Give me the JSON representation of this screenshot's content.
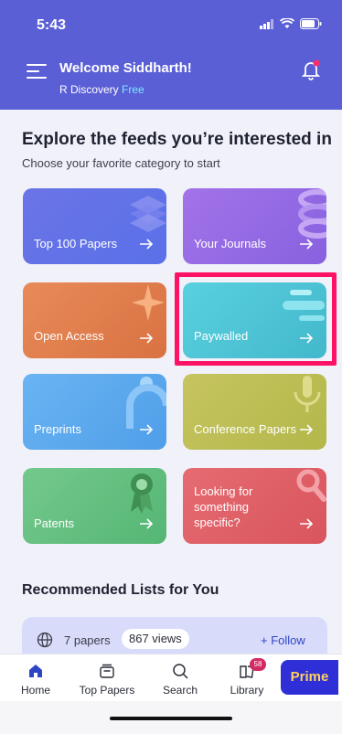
{
  "status_bar": {
    "time": "5:43"
  },
  "header": {
    "welcome": "Welcome Siddharth!",
    "app_name": "R Discovery",
    "plan": "Free"
  },
  "feeds": {
    "title": "Explore the feeds you’re interested in",
    "subtitle": "Choose your favorite category to start",
    "cards": [
      {
        "label": "Top 100 Papers",
        "color": "#6b74e6"
      },
      {
        "label": "Your Journals",
        "color": "#a273e9"
      },
      {
        "label": "Open Access",
        "color": "#e88a58"
      },
      {
        "label": "Paywalled",
        "color": "#59d0df",
        "highlighted": true
      },
      {
        "label": "Preprints",
        "color": "#6ab4f3"
      },
      {
        "label": "Conference Papers",
        "color": "#c6c460"
      },
      {
        "label": "Patents",
        "color": "#74c98c"
      },
      {
        "label": "Looking for something specific?",
        "color": "#e66b72"
      }
    ],
    "highlight_color": "#ff1265"
  },
  "recommended": {
    "title": "Recommended Lists for You",
    "papers": "7 papers",
    "views": "867 views",
    "follow": "+ Follow"
  },
  "nav": {
    "items": [
      {
        "label": "Home",
        "icon": "home-icon",
        "active": true
      },
      {
        "label": "Top Papers",
        "icon": "papers-icon"
      },
      {
        "label": "Search",
        "icon": "search-icon"
      },
      {
        "label": "Library",
        "icon": "library-icon",
        "badge": "58"
      }
    ],
    "prime": "Prime"
  }
}
